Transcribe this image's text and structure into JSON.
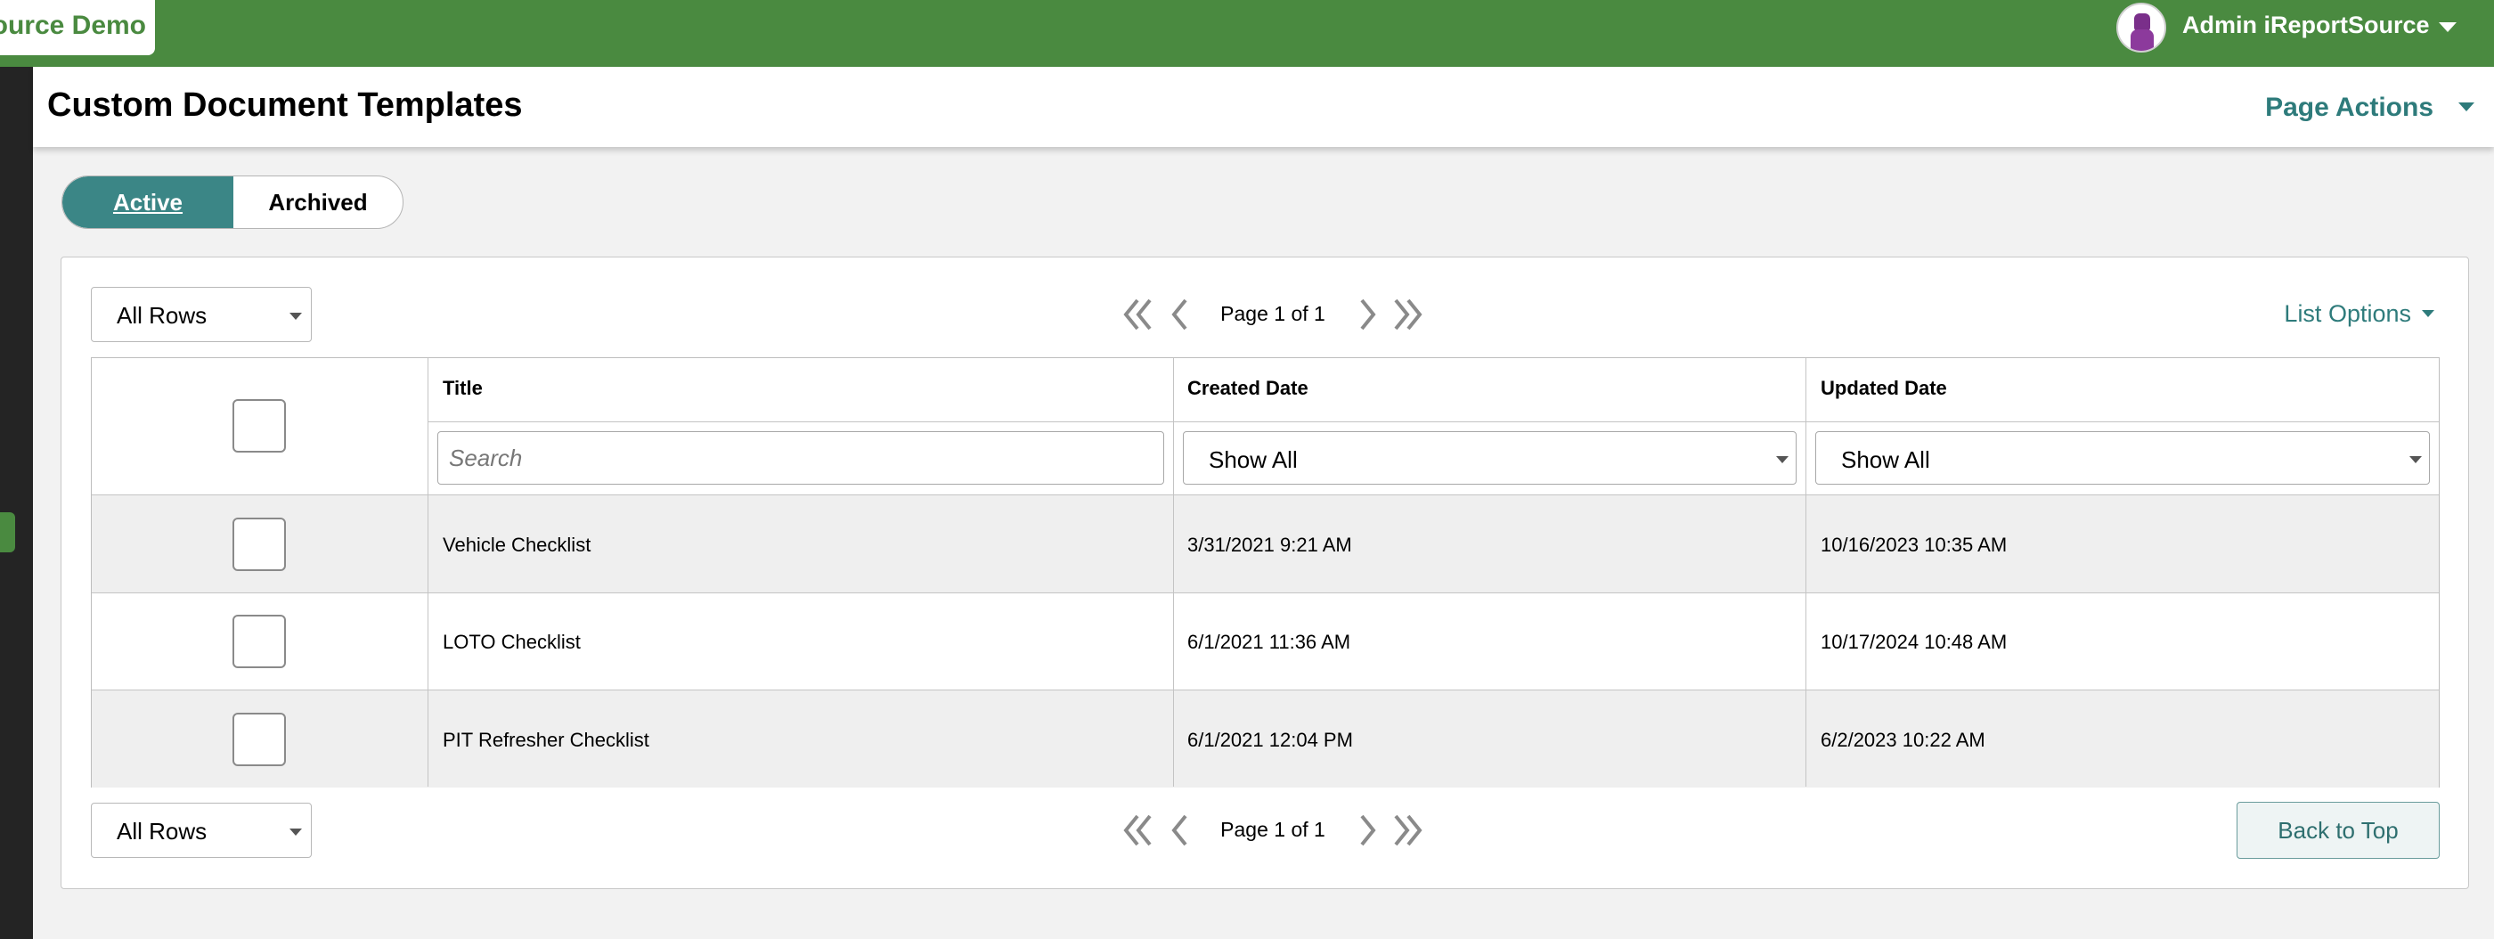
{
  "app": {
    "brand": "Source Demo",
    "user_name": "Admin iReportSource"
  },
  "header": {
    "title": "Custom Document Templates",
    "page_actions": "Page Actions"
  },
  "tabs": [
    {
      "label": "Active",
      "selected": true
    },
    {
      "label": "Archived",
      "selected": false
    }
  ],
  "list": {
    "rows_select": "All Rows",
    "page_label": "Page 1 of 1",
    "list_options": "List Options",
    "back_to_top": "Back to Top",
    "columns": {
      "title": "Title",
      "created": "Created Date",
      "updated": "Updated Date"
    },
    "filters": {
      "search_placeholder": "Search",
      "created": "Show All",
      "updated": "Show All"
    },
    "rows": [
      {
        "title": "Vehicle Checklist",
        "created": "3/31/2021 9:21 AM",
        "updated": "10/16/2023 10:35 AM"
      },
      {
        "title": "LOTO Checklist",
        "created": "6/1/2021 11:36 AM",
        "updated": "10/17/2024 10:48 AM"
      },
      {
        "title": "PIT Refresher Checklist",
        "created": "6/1/2021 12:04 PM",
        "updated": "6/2/2023 10:22 AM"
      }
    ]
  },
  "colors": {
    "brand_green": "#4a8a40",
    "accent_teal": "#3b8686",
    "link_teal": "#2e7b7b"
  }
}
